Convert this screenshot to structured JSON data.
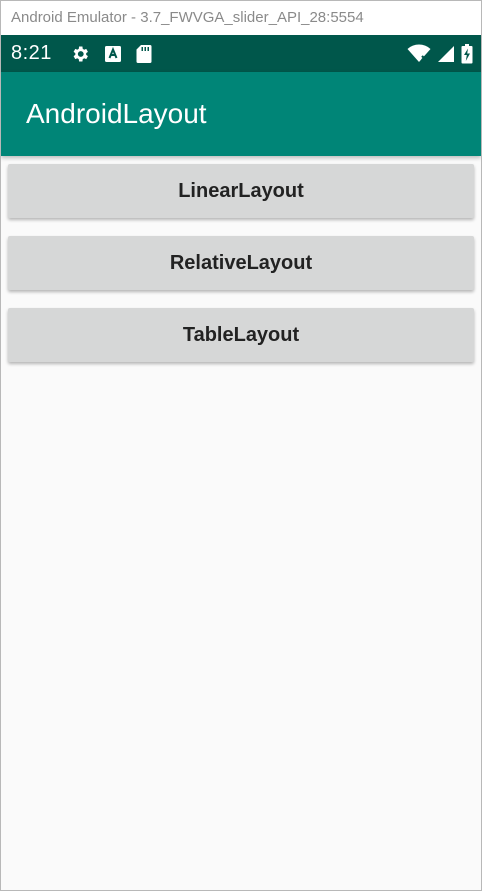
{
  "window": {
    "title": "Android Emulator - 3.7_FWVGA_slider_API_28:5554"
  },
  "status_bar": {
    "time": "8:21",
    "left_icons": [
      "gear-icon",
      "a-notification-icon",
      "sd-card-icon"
    ],
    "right_icons": [
      "wifi-icon",
      "cell-signal-icon",
      "battery-charging-icon"
    ],
    "background": "#00574b"
  },
  "app_bar": {
    "title": "AndroidLayout",
    "background": "#008577"
  },
  "buttons": [
    {
      "label": "LinearLayout"
    },
    {
      "label": "RelativeLayout"
    },
    {
      "label": "TableLayout"
    }
  ],
  "colors": {
    "button_bg": "#d6d7d7",
    "content_bg": "#fafafa"
  }
}
